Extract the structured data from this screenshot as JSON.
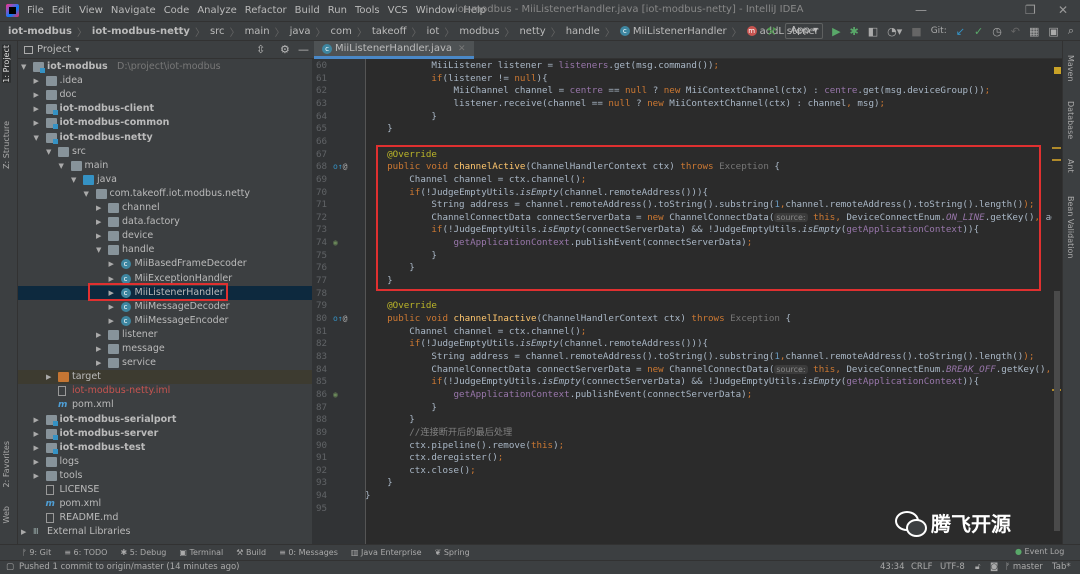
{
  "window": {
    "title": "iot-modbus - MiiListenerHandler.java [iot-modbus-netty] - IntelliJ IDEA"
  },
  "menu": [
    "File",
    "Edit",
    "View",
    "Navigate",
    "Code",
    "Analyze",
    "Refactor",
    "Build",
    "Run",
    "Tools",
    "VCS",
    "Window",
    "Help"
  ],
  "breadcrumb": [
    "iot-modbus",
    "iot-modbus-netty",
    "src",
    "main",
    "java",
    "com",
    "takeoff",
    "iot",
    "modbus",
    "netty",
    "handle",
    "MiiListenerHandler",
    "addListener"
  ],
  "toolbar": {
    "run_config": "App",
    "git_label": "Git:"
  },
  "project_panel": {
    "title": "Project"
  },
  "left_stripe": {
    "project": "1: Project",
    "structure": "Z: Structure",
    "favorites": "2: Favorites",
    "web": "Web"
  },
  "right_stripe": {
    "maven": "Maven",
    "database": "Database",
    "ant": "Ant",
    "bean": "Bean Validation"
  },
  "tree": [
    {
      "label": "iot-modbus",
      "level": 0,
      "arrow": "down",
      "icon": "module",
      "bold": true,
      "hint": "D:\\project\\iot-modbus"
    },
    {
      "label": ".idea",
      "level": 1,
      "arrow": "right",
      "icon": "folder"
    },
    {
      "label": "doc",
      "level": 1,
      "arrow": "right",
      "icon": "folder"
    },
    {
      "label": "iot-modbus-client",
      "level": 1,
      "arrow": "right",
      "icon": "module",
      "bold": true
    },
    {
      "label": "iot-modbus-common",
      "level": 1,
      "arrow": "right",
      "icon": "module",
      "bold": true
    },
    {
      "label": "iot-modbus-netty",
      "level": 1,
      "arrow": "down",
      "icon": "module",
      "bold": true
    },
    {
      "label": "src",
      "level": 2,
      "arrow": "down",
      "icon": "folder"
    },
    {
      "label": "main",
      "level": 3,
      "arrow": "down",
      "icon": "folder"
    },
    {
      "label": "java",
      "level": 4,
      "arrow": "down",
      "icon": "source-folder"
    },
    {
      "label": "com.takeoff.iot.modbus.netty",
      "level": 5,
      "arrow": "down",
      "icon": "package"
    },
    {
      "label": "channel",
      "level": 6,
      "arrow": "right",
      "icon": "package"
    },
    {
      "label": "data.factory",
      "level": 6,
      "arrow": "right",
      "icon": "package"
    },
    {
      "label": "device",
      "level": 6,
      "arrow": "right",
      "icon": "package"
    },
    {
      "label": "handle",
      "level": 6,
      "arrow": "down",
      "icon": "package"
    },
    {
      "label": "MiiBasedFrameDecoder",
      "level": 7,
      "arrow": "right",
      "icon": "class"
    },
    {
      "label": "MiiExceptionHandler",
      "level": 7,
      "arrow": "right",
      "icon": "class"
    },
    {
      "label": "MiiListenerHandler",
      "level": 7,
      "arrow": "right",
      "icon": "class",
      "selected": true
    },
    {
      "label": "MiiMessageDecoder",
      "level": 7,
      "arrow": "right",
      "icon": "class"
    },
    {
      "label": "MiiMessageEncoder",
      "level": 7,
      "arrow": "right",
      "icon": "class"
    },
    {
      "label": "listener",
      "level": 6,
      "arrow": "right",
      "icon": "package"
    },
    {
      "label": "message",
      "level": 6,
      "arrow": "right",
      "icon": "package"
    },
    {
      "label": "service",
      "level": 6,
      "arrow": "right",
      "icon": "package"
    },
    {
      "label": "target",
      "level": 2,
      "arrow": "right",
      "icon": "excluded-folder",
      "target": true
    },
    {
      "label": "iot-modbus-netty.iml",
      "level": 2,
      "arrow": "none",
      "icon": "file",
      "color": "#c75450"
    },
    {
      "label": "pom.xml",
      "level": 2,
      "arrow": "none",
      "icon": "maven"
    },
    {
      "label": "iot-modbus-serialport",
      "level": 1,
      "arrow": "right",
      "icon": "module",
      "bold": true
    },
    {
      "label": "iot-modbus-server",
      "level": 1,
      "arrow": "right",
      "icon": "module",
      "bold": true
    },
    {
      "label": "iot-modbus-test",
      "level": 1,
      "arrow": "right",
      "icon": "module",
      "bold": true
    },
    {
      "label": "logs",
      "level": 1,
      "arrow": "right",
      "icon": "folder"
    },
    {
      "label": "tools",
      "level": 1,
      "arrow": "right",
      "icon": "folder"
    },
    {
      "label": "LICENSE",
      "level": 1,
      "arrow": "none",
      "icon": "file"
    },
    {
      "label": "pom.xml",
      "level": 1,
      "arrow": "none",
      "icon": "maven"
    },
    {
      "label": "README.md",
      "level": 1,
      "arrow": "none",
      "icon": "file"
    },
    {
      "label": "External Libraries",
      "level": 0,
      "arrow": "right",
      "icon": "libraries"
    }
  ],
  "editor": {
    "tab": "MiiListenerHandler.java",
    "lines": [
      {
        "n": "60",
        "t": [
          [
            "            MiiListener listener = ",
            ""
          ],
          [
            "listeners",
            "fd"
          ],
          [
            ".get(msg.command())",
            ""
          ],
          [
            ";",
            "kw"
          ]
        ]
      },
      {
        "n": "61",
        "t": [
          [
            "            ",
            ""
          ],
          [
            "if",
            "kw"
          ],
          [
            "(listener != ",
            ""
          ],
          [
            "null",
            "kw"
          ],
          [
            "){",
            ""
          ]
        ]
      },
      {
        "n": "62",
        "t": [
          [
            "                MiiChannel channel = ",
            ""
          ],
          [
            "centre",
            "fd"
          ],
          [
            " == ",
            ""
          ],
          [
            "null",
            "kw"
          ],
          [
            " ? ",
            ""
          ],
          [
            "new",
            "kw"
          ],
          [
            " MiiContextChannel(ctx) : ",
            ""
          ],
          [
            "centre",
            "fd"
          ],
          [
            ".get(msg.deviceGroup())",
            ""
          ],
          [
            ";",
            "kw"
          ]
        ]
      },
      {
        "n": "63",
        "t": [
          [
            "                listener.receive(channel == ",
            ""
          ],
          [
            "null",
            "kw"
          ],
          [
            " ? ",
            ""
          ],
          [
            "new",
            "kw"
          ],
          [
            " MiiContextChannel(ctx) : channel",
            ""
          ],
          [
            ",",
            "kw"
          ],
          [
            " msg)",
            ""
          ],
          [
            ";",
            "kw"
          ]
        ]
      },
      {
        "n": "64",
        "t": [
          [
            "            }",
            ""
          ]
        ]
      },
      {
        "n": "65",
        "t": [
          [
            "    }",
            ""
          ]
        ]
      },
      {
        "n": "66",
        "t": []
      },
      {
        "n": "67",
        "t": [
          [
            "    ",
            ""
          ],
          [
            "@Override",
            "an"
          ]
        ]
      },
      {
        "n": "68",
        "g": "override",
        "t": [
          [
            "    ",
            ""
          ],
          [
            "public void ",
            "kw"
          ],
          [
            "channelActive",
            "fn"
          ],
          [
            "(ChannelHandlerContext ctx) ",
            ""
          ],
          [
            "throws ",
            "kw"
          ],
          [
            "Exception",
            "ex"
          ],
          [
            " {",
            ""
          ]
        ]
      },
      {
        "n": "69",
        "t": [
          [
            "        Channel channel = ctx.channel()",
            ""
          ],
          [
            ";",
            "kw"
          ]
        ]
      },
      {
        "n": "70",
        "t": [
          [
            "        ",
            ""
          ],
          [
            "if",
            "kw"
          ],
          [
            "(!JudgeEmptyUtils.",
            ""
          ],
          [
            "isEmpty",
            "it"
          ],
          [
            "(channel.remoteAddress())){",
            ""
          ]
        ]
      },
      {
        "n": "71",
        "t": [
          [
            "            String address = channel.remoteAddress().toString().substring(",
            ""
          ],
          [
            "1",
            "num"
          ],
          [
            ",",
            "kw"
          ],
          [
            "channel.remoteAddress().toString().length()",
            ""
          ],
          [
            ");",
            "kw"
          ]
        ]
      },
      {
        "n": "72",
        "t": [
          [
            "            ChannelConnectData connectServerData = ",
            ""
          ],
          [
            "new",
            "kw"
          ],
          [
            " ChannelConnectData(",
            ""
          ],
          [
            "source:",
            "inlay"
          ],
          [
            " ",
            ""
          ],
          [
            "this",
            "kw"
          ],
          [
            ", ",
            "kw"
          ],
          [
            "DeviceConnectEnum.",
            ""
          ],
          [
            "ON_LINE",
            "cst"
          ],
          [
            ".getKey()",
            ""
          ],
          [
            ", ",
            "kw"
          ],
          [
            "ad",
            ""
          ]
        ]
      },
      {
        "n": "73",
        "t": [
          [
            "            ",
            ""
          ],
          [
            "if",
            "kw"
          ],
          [
            "(!JudgeEmptyUtils.",
            ""
          ],
          [
            "isEmpty",
            "it"
          ],
          [
            "(connectServerData) && !JudgeEmptyUtils.",
            ""
          ],
          [
            "isEmpty",
            "it"
          ],
          [
            "(",
            ""
          ],
          [
            "getApplicationContext",
            "fd"
          ],
          [
            ")){",
            ""
          ]
        ]
      },
      {
        "n": "74",
        "g": "spring",
        "t": [
          [
            "                ",
            ""
          ],
          [
            "getApplicationContext",
            "fd"
          ],
          [
            ".publishEvent(connectServerData)",
            ""
          ],
          [
            ";",
            "kw"
          ]
        ]
      },
      {
        "n": "75",
        "t": [
          [
            "            }",
            ""
          ]
        ]
      },
      {
        "n": "76",
        "t": [
          [
            "        }",
            ""
          ]
        ]
      },
      {
        "n": "77",
        "t": [
          [
            "    }",
            ""
          ]
        ]
      },
      {
        "n": "78",
        "t": []
      },
      {
        "n": "79",
        "t": [
          [
            "    ",
            ""
          ],
          [
            "@Override",
            "an"
          ]
        ]
      },
      {
        "n": "80",
        "g": "override",
        "t": [
          [
            "    ",
            ""
          ],
          [
            "public void ",
            "kw"
          ],
          [
            "channelInactive",
            "fn"
          ],
          [
            "(ChannelHandlerContext ctx) ",
            ""
          ],
          [
            "throws ",
            "kw"
          ],
          [
            "Exception",
            "ex"
          ],
          [
            " {",
            ""
          ]
        ]
      },
      {
        "n": "81",
        "t": [
          [
            "        Channel channel = ctx.channel()",
            ""
          ],
          [
            ";",
            "kw"
          ]
        ]
      },
      {
        "n": "82",
        "t": [
          [
            "        ",
            ""
          ],
          [
            "if",
            "kw"
          ],
          [
            "(!JudgeEmptyUtils.",
            ""
          ],
          [
            "isEmpty",
            "it"
          ],
          [
            "(channel.remoteAddress())){",
            ""
          ]
        ]
      },
      {
        "n": "83",
        "t": [
          [
            "            String address = channel.remoteAddress().toString().substring(",
            ""
          ],
          [
            "1",
            "num"
          ],
          [
            ",",
            "kw"
          ],
          [
            "channel.remoteAddress().toString().length()",
            ""
          ],
          [
            ");",
            "kw"
          ]
        ]
      },
      {
        "n": "84",
        "t": [
          [
            "            ChannelConnectData connectServerData = ",
            ""
          ],
          [
            "new",
            "kw"
          ],
          [
            " ChannelConnectData(",
            ""
          ],
          [
            "source:",
            "inlay"
          ],
          [
            " ",
            ""
          ],
          [
            "this",
            "kw"
          ],
          [
            ", ",
            "kw"
          ],
          [
            "DeviceConnectEnum.",
            ""
          ],
          [
            "BREAK_OFF",
            "cst"
          ],
          [
            ".getKey()",
            ""
          ],
          [
            ",",
            "kw"
          ]
        ]
      },
      {
        "n": "85",
        "t": [
          [
            "            ",
            ""
          ],
          [
            "if",
            "kw"
          ],
          [
            "(!JudgeEmptyUtils.",
            ""
          ],
          [
            "isEmpty",
            "it"
          ],
          [
            "(connectServerData) && !JudgeEmptyUtils.",
            ""
          ],
          [
            "isEmpty",
            "it"
          ],
          [
            "(",
            ""
          ],
          [
            "getApplicationContext",
            "fd"
          ],
          [
            ")){",
            ""
          ]
        ]
      },
      {
        "n": "86",
        "g": "spring",
        "t": [
          [
            "                ",
            ""
          ],
          [
            "getApplicationContext",
            "fd"
          ],
          [
            ".publishEvent(connectServerData)",
            ""
          ],
          [
            ";",
            "kw"
          ]
        ]
      },
      {
        "n": "87",
        "t": [
          [
            "            }",
            ""
          ]
        ]
      },
      {
        "n": "88",
        "t": [
          [
            "        }",
            ""
          ]
        ]
      },
      {
        "n": "89",
        "t": [
          [
            "        ",
            ""
          ],
          [
            "//连接断开后的最后处理",
            "cm"
          ]
        ]
      },
      {
        "n": "90",
        "t": [
          [
            "        ctx.pipeline().remove(",
            ""
          ],
          [
            "this",
            "kw"
          ],
          [
            ")",
            ""
          ],
          [
            ";",
            "kw"
          ]
        ]
      },
      {
        "n": "91",
        "t": [
          [
            "        ctx.deregister()",
            ""
          ],
          [
            ";",
            "kw"
          ]
        ]
      },
      {
        "n": "92",
        "t": [
          [
            "        ctx.close()",
            ""
          ],
          [
            ";",
            "kw"
          ]
        ]
      },
      {
        "n": "93",
        "t": [
          [
            "    }",
            ""
          ]
        ]
      },
      {
        "n": "94",
        "t": [
          [
            "}",
            ""
          ]
        ]
      },
      {
        "n": "95",
        "t": []
      }
    ]
  },
  "bottom_tools": [
    "9: Git",
    "6: TODO",
    "5: Debug",
    "Terminal",
    "Build",
    "0: Messages",
    "Java Enterprise",
    "Spring"
  ],
  "event_log": "Event Log",
  "status": {
    "message": "Pushed 1 commit to origin/master (14 minutes ago)",
    "position": "43:34",
    "line_sep": "CRLF",
    "encoding": "UTF-8",
    "branch": "master",
    "indent": "Tab*"
  },
  "watermark": "腾飞开源",
  "colors": {
    "highlight_box": "#e03030",
    "selection": "#0d293e",
    "editor_bg": "#2b2b2b"
  }
}
